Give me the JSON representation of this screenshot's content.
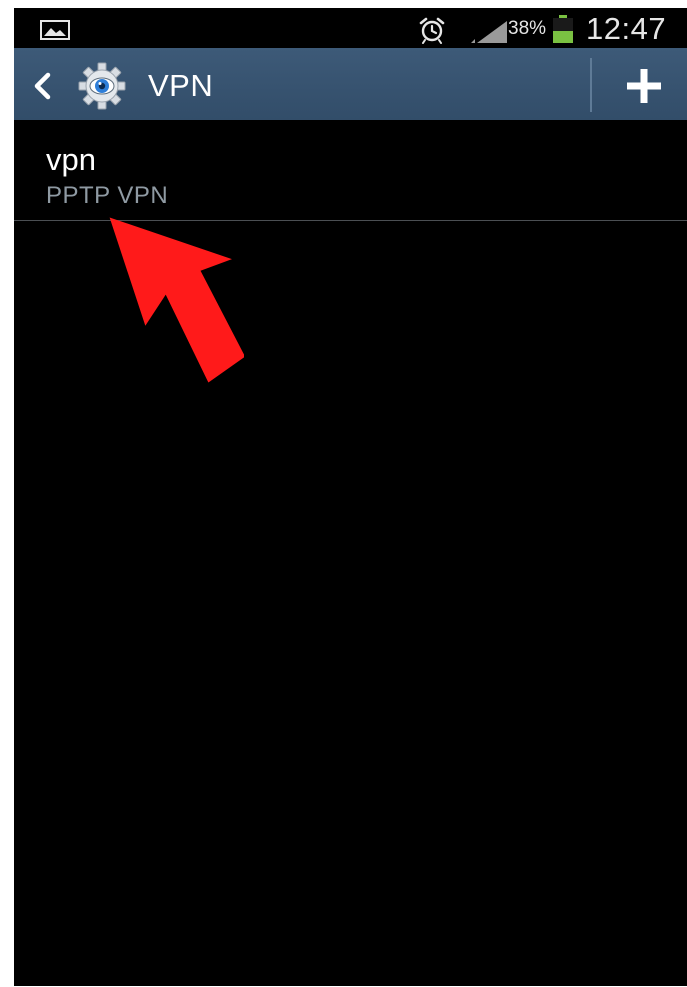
{
  "status_bar": {
    "battery_percent": "38%",
    "time": "12:47",
    "icons": [
      "gallery-icon",
      "alarm-icon",
      "signal-icon",
      "battery-icon"
    ],
    "battery_color": "#7ac142"
  },
  "action_bar": {
    "title": "VPN",
    "icons": [
      "chevron-left-icon",
      "settings-icon",
      "plus-icon"
    ],
    "background_color": "#3a5673"
  },
  "vpn_list": [
    {
      "name": "vpn",
      "type": "PPTP VPN"
    }
  ],
  "annotation": {
    "icon": "red-arrow",
    "color": "#ff1a1a"
  }
}
